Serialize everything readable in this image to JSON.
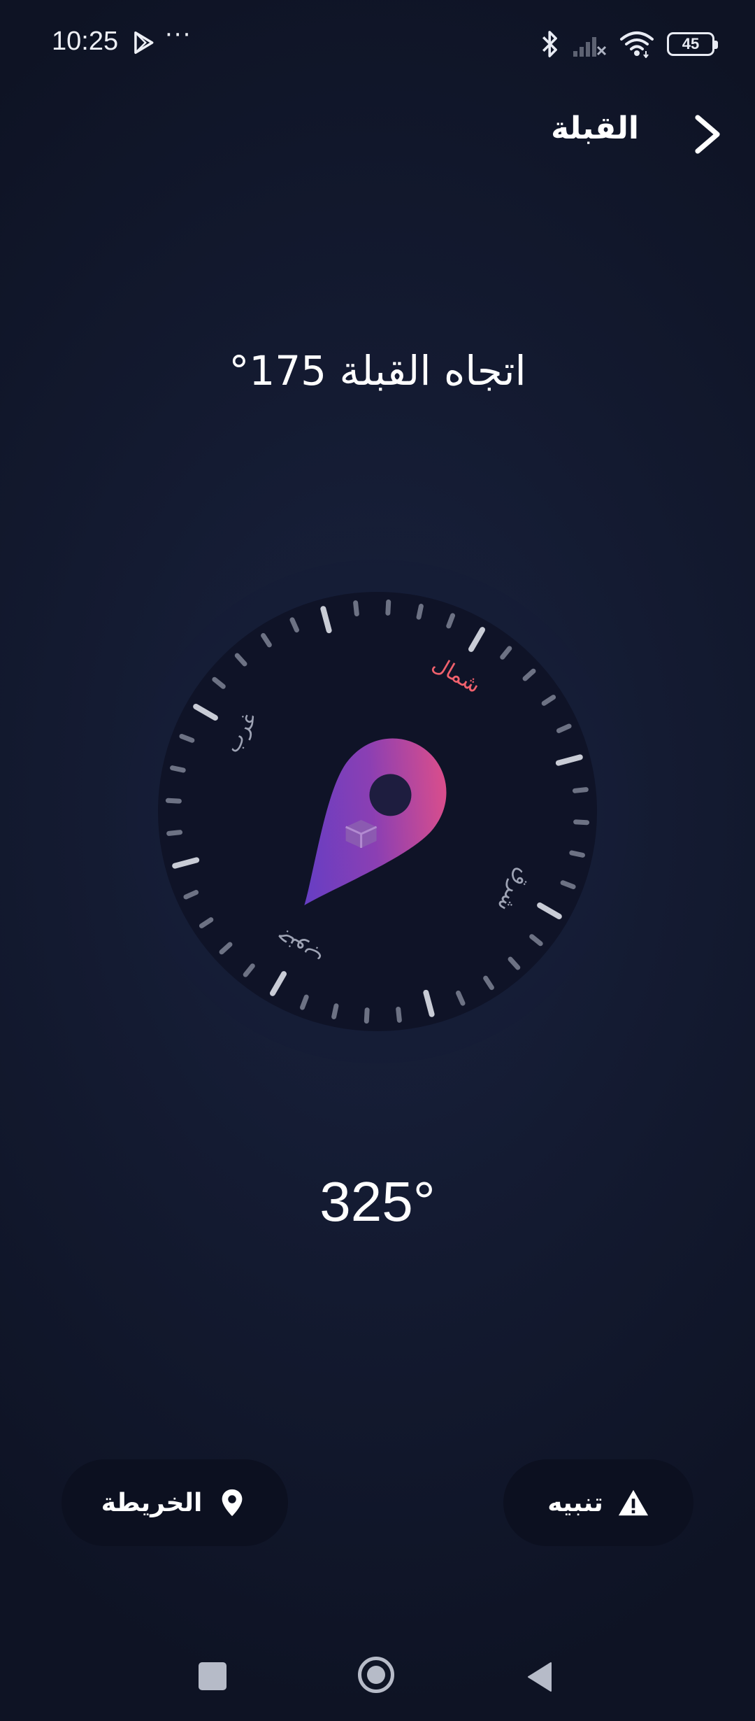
{
  "status_bar": {
    "time": "10:25",
    "more_glyph": "···",
    "battery_level": "45",
    "icons": [
      "play-store-icon",
      "more-dots-icon",
      "bluetooth-icon",
      "cellular-no-signal-icon",
      "wifi-icon",
      "battery-icon"
    ]
  },
  "header": {
    "title": "القبلة",
    "back_icon": "chevron-right-icon"
  },
  "qibla": {
    "direction_text": "اتجاه القبلة 175°"
  },
  "compass": {
    "north_label": "شمال",
    "east_label": "شرق",
    "south_label": "جنوب",
    "west_label": "غرب",
    "colors": {
      "north": "#f0616d",
      "labels": "#9ea3b4",
      "pin_top": "#6f3fcf",
      "pin_bottom": "#e14f88",
      "dial": "#10142a"
    }
  },
  "heading": {
    "value": "325°"
  },
  "buttons": {
    "map_label": "الخريطة",
    "alert_label": "تنبيه"
  },
  "nav_bar": {
    "icons": [
      "recents-icon",
      "home-icon",
      "back-icon"
    ]
  }
}
